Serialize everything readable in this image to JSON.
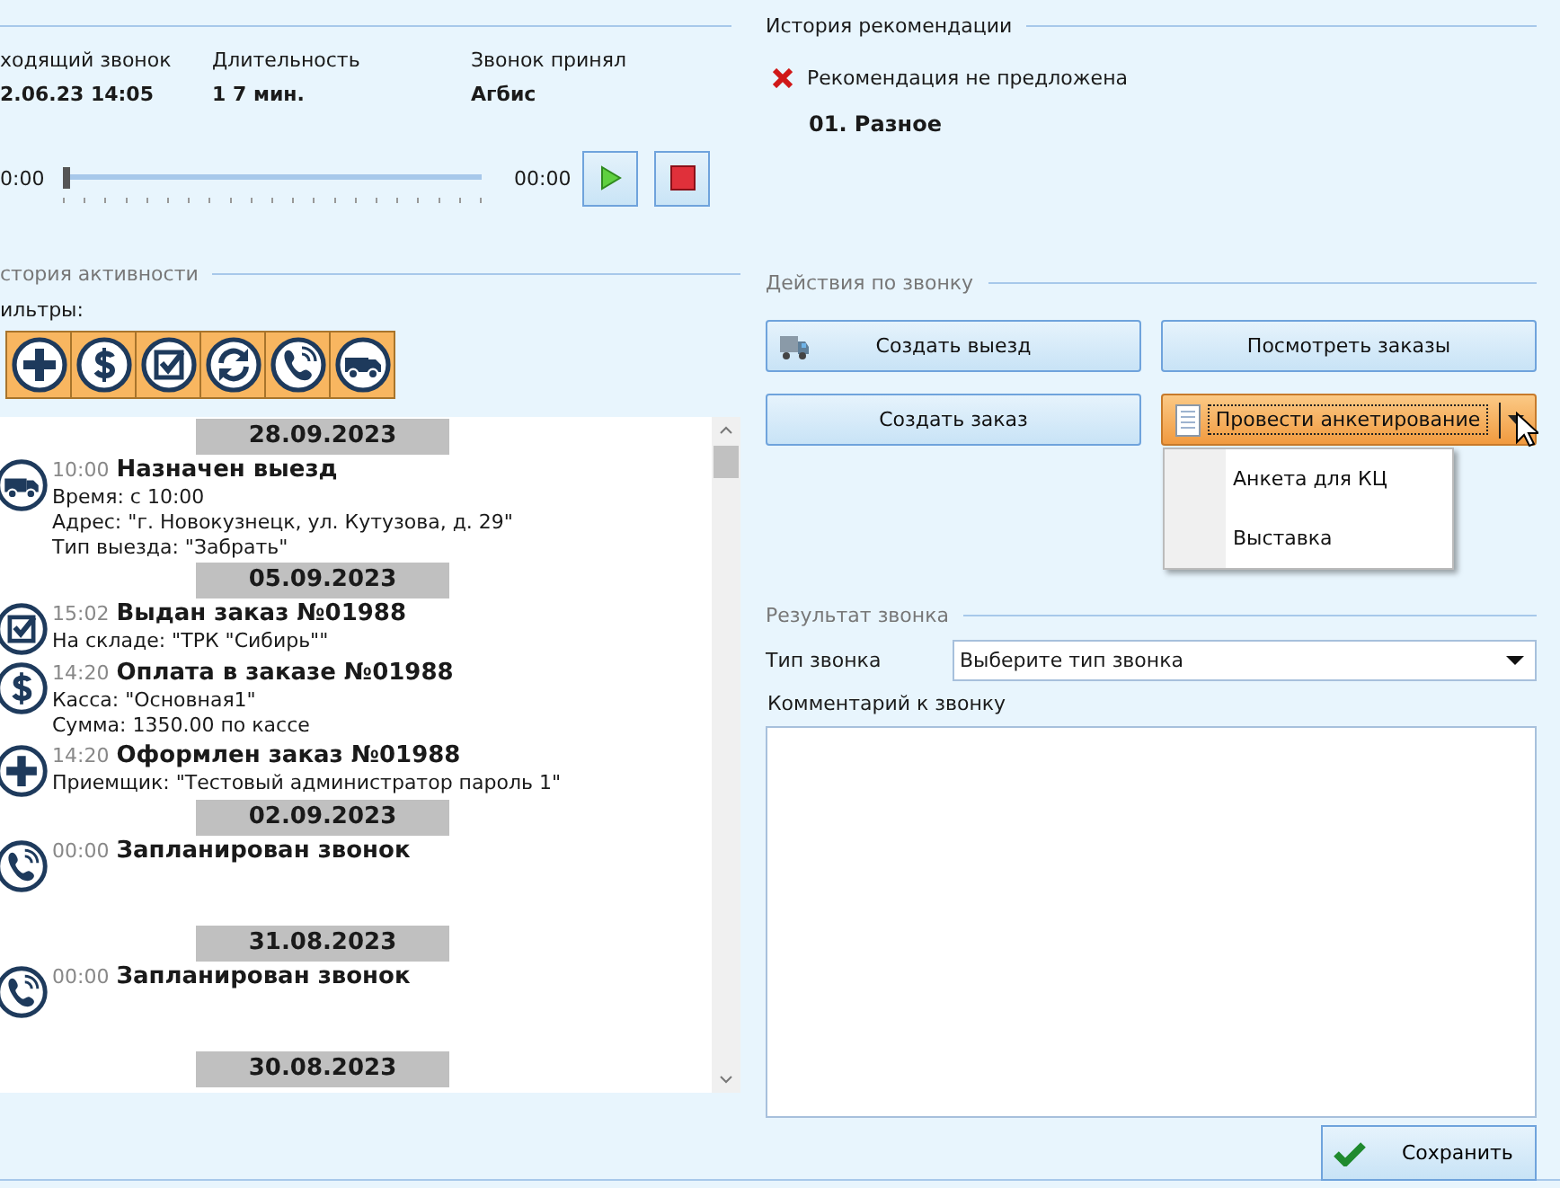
{
  "call_info": {
    "columns": [
      {
        "label": "ходящий звонок",
        "value": "2.06.23 14:05"
      },
      {
        "label": "Длительность",
        "value": "1 7 мин."
      },
      {
        "label": "Звонок принял",
        "value": "Агбис"
      }
    ]
  },
  "player": {
    "start": "0:00",
    "end": "00:00",
    "level": 0
  },
  "activity": {
    "title": "стория активности",
    "filters_label": "ильтры:",
    "filters": [
      {
        "kind": "add"
      },
      {
        "kind": "payment"
      },
      {
        "kind": "issued"
      },
      {
        "kind": "refresh"
      },
      {
        "kind": "call"
      },
      {
        "kind": "visit"
      }
    ],
    "feed": [
      {
        "date": "28.09.2023",
        "events": [
          {
            "kind": "visit",
            "time": "10:00",
            "title": "Назначен выезд",
            "details": [
              "Время: с 10:00",
              "Адрес: \"г. Новокузнецк, ул. Кутузова, д. 29\"",
              "Тип выезда: \"Забрать\""
            ]
          }
        ]
      },
      {
        "date": "05.09.2023",
        "events": [
          {
            "kind": "issued",
            "time": "15:02",
            "title": "Выдан заказ №01988",
            "details": [
              "На складе: \"ТРК \"Сибирь\"\""
            ]
          },
          {
            "kind": "payment",
            "time": "14:20",
            "title": "Оплата в заказе №01988",
            "details": [
              "Касса: \"Основная1\"",
              "Сумма: 1350.00 по кассе"
            ]
          },
          {
            "kind": "add",
            "time": "14:20",
            "title": "Оформлен заказ №01988",
            "details": [
              "Приемщик: \"Тестовый администратор пароль 1\""
            ]
          }
        ]
      },
      {
        "date": "02.09.2023",
        "events": [
          {
            "kind": "call",
            "time": "00:00",
            "title": "Запланирован звонок"
          }
        ]
      },
      {
        "date": "31.08.2023",
        "events": [
          {
            "kind": "call",
            "time": "00:00",
            "title": "Запланирован звонок"
          }
        ]
      },
      {
        "date": "30.08.2023"
      }
    ]
  },
  "recommendation": {
    "title": "История рекомендации",
    "status": "Рекомендация не предложена",
    "category": "01. Разное"
  },
  "actions": {
    "title": "Действия по звонку",
    "buttons": [
      {
        "kind": "truck",
        "label": "Создать выезд",
        "active": false
      },
      {
        "kind": "plain",
        "label": "Посмотреть заказы",
        "active": false
      },
      {
        "kind": "plain",
        "label": "Создать заказ",
        "active": false
      },
      {
        "kind": "split",
        "label": "Провести анкетирование",
        "active": true
      }
    ],
    "menu": {
      "items": [
        "Анкета для КЦ",
        "Выставка"
      ]
    }
  },
  "result": {
    "title": "Результат звонка",
    "type_label": "Тип звонка",
    "type_value": "Выберите тип звонка",
    "comment_label": "Комментарий к звонку"
  },
  "save_button": "Сохранить"
}
